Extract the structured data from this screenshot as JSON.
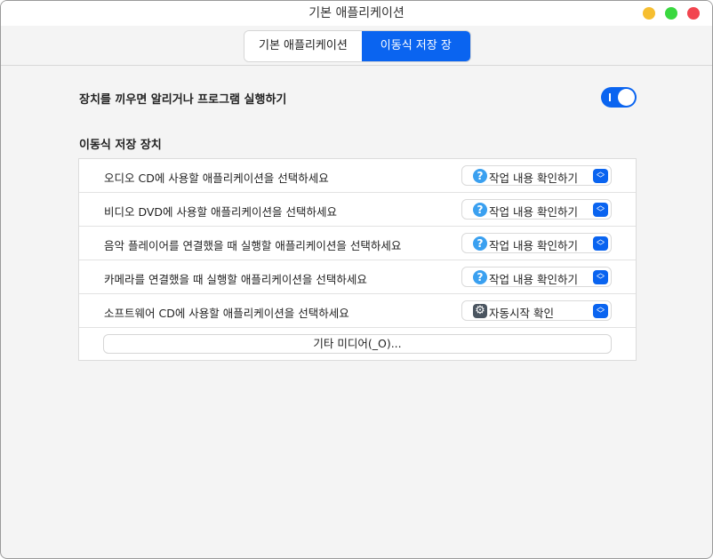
{
  "window": {
    "title": "기본 애플리케이션",
    "controls": {
      "minimize": "#f6be30",
      "maximize": "#39d83f",
      "close": "#f2454f"
    }
  },
  "tabs": [
    {
      "label": "기본 애플리케이션",
      "active": false
    },
    {
      "label": "이동식 저장 장치",
      "active": true
    }
  ],
  "autorun": {
    "label": "장치를 끼우면 알리거나 프로그램 실행하기",
    "enabled": true
  },
  "section": {
    "title": "이동식 저장 장치"
  },
  "rows": [
    {
      "label": "오디오 CD에 사용할 애플리케이션을 선택하세요",
      "value": "작업 내용 확인하기",
      "icon": "question-icon"
    },
    {
      "label": "비디오 DVD에 사용할 애플리케이션을 선택하세요",
      "value": "작업 내용 확인하기",
      "icon": "question-icon"
    },
    {
      "label": "음악 플레이어를 연결했을 때 실행할 애플리케이션을 선택하세요",
      "value": "작업 내용 확인하기",
      "icon": "question-icon"
    },
    {
      "label": "카메라를 연결했을 때 실행할 애플리케이션을 선택하세요",
      "value": "작업 내용 확인하기",
      "icon": "question-icon"
    },
    {
      "label": "소프트웨어 CD에 사용할 애플리케이션을 선택하세요",
      "value": "자동시작 확인",
      "icon": "gear-icon"
    }
  ],
  "other_media": "기타 미디어(_O)...",
  "accent": "#0a64f0"
}
